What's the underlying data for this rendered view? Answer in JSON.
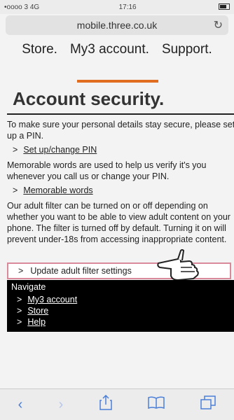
{
  "status_bar": {
    "carrier": "•oooo 3  4G",
    "time": "17:16"
  },
  "url": "mobile.three.co.uk",
  "nav": {
    "items": [
      "Store.",
      "My3 account.",
      "Support."
    ]
  },
  "page": {
    "title": "Account security.",
    "p1": "To make sure your personal details stay secure, please set up a PIN.",
    "link1": "Set up/change PIN",
    "p2": "Memorable words are used to help us verify it's you whenever you call us or change your PIN.",
    "link2": "Memorable words",
    "p3": "Our adult filter can be turned on or off depending on whether you want to be able to view adult content on your phone. The filter is turned off by default. Turning it on will prevent under-18s from accessing inappropriate content.",
    "link3": "Update adult filter settings"
  },
  "navigate": {
    "heading": "Navigate",
    "links": [
      "My3 account",
      "Store",
      "Help"
    ]
  },
  "arrow": ">",
  "toolbar": {
    "icons": [
      "chevron-left-icon",
      "chevron-right-icon",
      "share-icon",
      "bookmarks-icon",
      "tabs-icon"
    ],
    "accent": "#4a7ed8"
  }
}
